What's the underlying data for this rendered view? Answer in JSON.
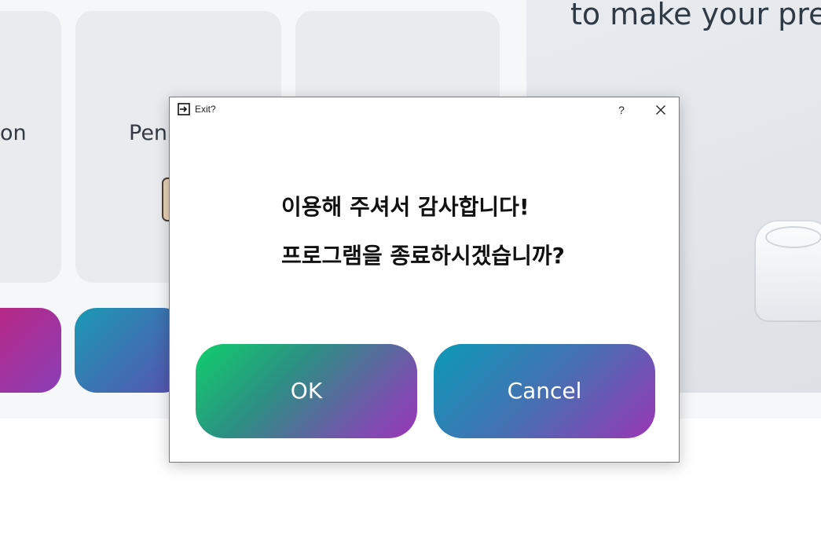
{
  "background": {
    "cards": [
      {
        "label": "on"
      },
      {
        "label": "Pen"
      },
      {
        "label": ""
      }
    ],
    "hero_text": "to make your pres"
  },
  "dialog": {
    "title": "Exit?",
    "help_label": "?",
    "message_line1": "이용해 주셔서 감사합니다!",
    "message_line2": "프로그램을 종료하시겠습니까?",
    "ok_label": "OK",
    "cancel_label": "Cancel"
  },
  "colors": {
    "ok_gradient_start": "#0fcf6c",
    "ok_gradient_end": "#9a36b5",
    "cancel_gradient_start": "#0b9ab8",
    "cancel_gradient_end": "#9a36b5"
  }
}
